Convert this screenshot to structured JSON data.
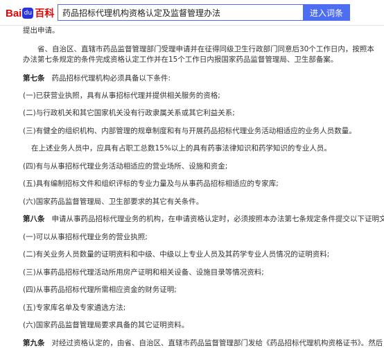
{
  "header": {
    "logo_bai": "Bai",
    "logo_du": "du",
    "logo_baike": "百科",
    "search_value": "药品招标代理机构资格认定及监督管理办法",
    "search_button": "进入词条"
  },
  "article": {
    "p0": "提出申请。",
    "p1": "省、自治区、直辖市药品监督管理部门受理申请并在征得同级卫生行政部门同意后30个工作日内，按照本办法第七条规定的条件完成资格认定工作并在15个工作日内报国家药品监督管理局、卫生部备案。",
    "a7_label": "第七条",
    "a7_text": "药品招标代理机构必须具备以下条件:",
    "a7_1": "(一)已获营业执照，具有从事招标代理并提供相关服务的资格;",
    "a7_2": "(二)与行政机关和其它国家机关没有行政隶属关系或其它利益关系;",
    "a7_3": "(三)有健全的组织机构、内部管理的规章制度和有与开展药品招标代理业务活动相适应的业务人员数量。",
    "a7_3b": "在上述业务人员中，应具有占职工总数15%以上的具有药事法律知识和药学知识的专业人员。",
    "a7_4": "(四)有与从事招标代理业务活动相适应的营业场所、设施和资金;",
    "a7_5": "(五)具有编制招标文件和组织评标的专业力量及与从事药品招标相适应的专家库;",
    "a7_6": "(六)国家药品监督管理局、卫生部要求的其它有关条件。",
    "a8_label": "第八条",
    "a8_text": "申请从事药品招标代理业务的机构，在申请资格认定时，必须按照本办法第七条规定条件提交以下证明文件:",
    "a8_1": "(一)可以从事招标代理业务的营业执照;",
    "a8_2": "(二)有关业务人员数量的证明资料和中级、中级以上专业人员及其药学专业人员情况的证明资料;",
    "a8_3": "(三)从事药品招标代理活动所用房产证明和相关设备、设施目录等情况资料;",
    "a8_4": "(四)从事药品招标代理所需相应资金的财务证明;",
    "a8_5": "(五)专家库名单及专家遴选方法;",
    "a8_6": "(六)国家药品监督管理局要求具备的其它证明资料。",
    "a9_label": "第九条",
    "a9_text": "对经过资格认定的，由省、自治区、直辖市药品监督管理部门发给《药品招标代理机构资格证书》。然后，凭该证"
  }
}
